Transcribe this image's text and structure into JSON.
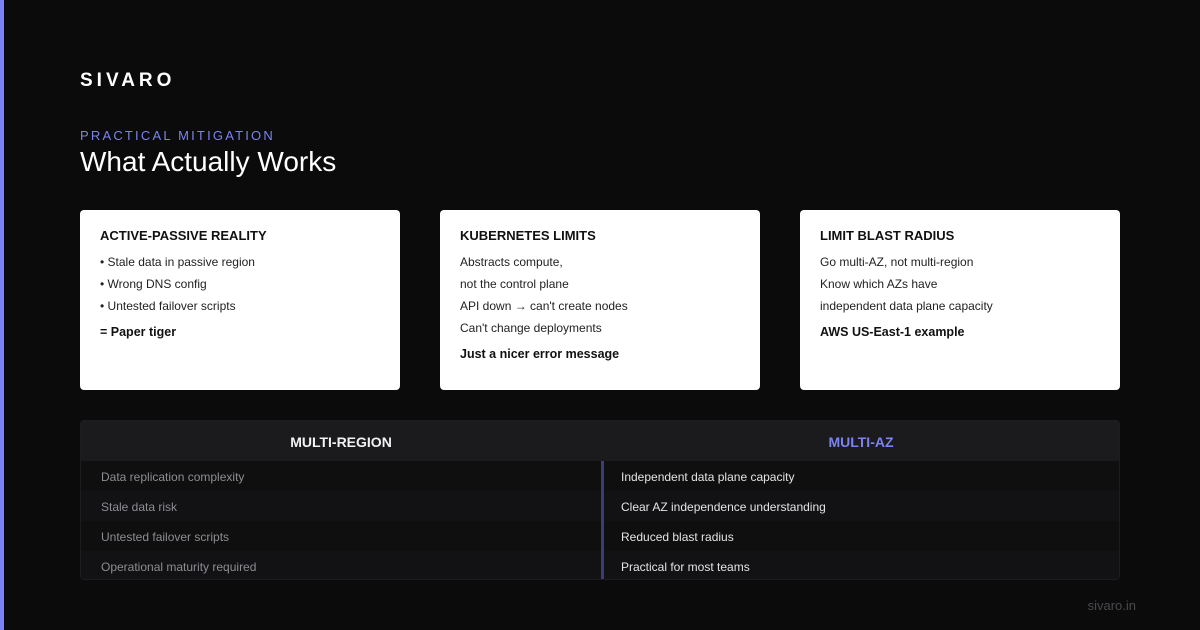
{
  "brand": "SIVARO",
  "eyebrow": "PRACTICAL MITIGATION",
  "title": "What Actually Works",
  "cards": [
    {
      "title": "ACTIVE-PASSIVE REALITY",
      "lines": [
        "• Stale data in passive region",
        "• Wrong DNS config",
        "• Untested failover scripts"
      ],
      "conclusion": "= Paper tiger"
    },
    {
      "title": "KUBERNETES LIMITS",
      "lines": [
        "Abstracts compute,",
        "not the control plane",
        "API down → can't create nodes",
        "Can't change deployments"
      ],
      "conclusion": "Just a nicer error message"
    },
    {
      "title": "LIMIT BLAST RADIUS",
      "lines": [
        "Go multi-AZ, not multi-region",
        "Know which AZs have",
        "independent data plane capacity"
      ],
      "conclusion": "AWS US-East-1 example"
    }
  ],
  "comparison": {
    "left": {
      "heading": "MULTI-REGION",
      "rows": [
        "Data replication complexity",
        "Stale data risk",
        "Untested failover scripts",
        "Operational maturity required"
      ]
    },
    "right": {
      "heading": "MULTI-AZ",
      "rows": [
        "Independent data plane capacity",
        "Clear AZ independence understanding",
        "Reduced blast radius",
        "Practical for most teams"
      ]
    }
  },
  "footer": "sivaro.in",
  "colors": {
    "accent": "#7b83f0",
    "background": "#0b0b0c",
    "card": "#ffffff"
  }
}
